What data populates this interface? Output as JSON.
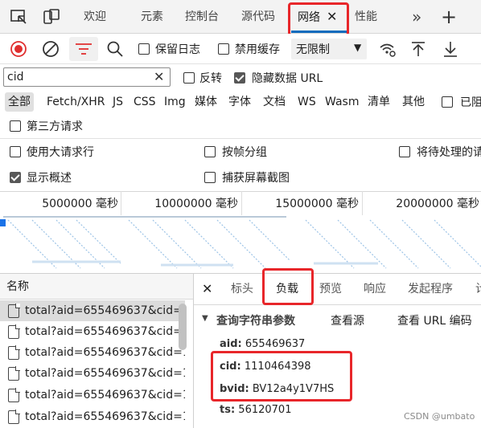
{
  "top_tabs": [
    {
      "label": "欢迎"
    },
    {
      "label": "元素"
    },
    {
      "label": "控制台"
    },
    {
      "label": "源代码"
    },
    {
      "label": "网络",
      "active": true
    },
    {
      "label": "性能"
    }
  ],
  "toolbar": {
    "preserve_log": "保留日志",
    "disable_cache": "禁用缓存",
    "throttling": "无限制"
  },
  "filter": {
    "value": "cid",
    "invert": "反转",
    "hide_data_urls": "隐藏数据 URL"
  },
  "type_filters": [
    "全部",
    "Fetch/XHR",
    "JS",
    "CSS",
    "Img",
    "媒体",
    "字体",
    "文档",
    "WS",
    "Wasm",
    "清单",
    "其他",
    "已阻"
  ],
  "third_party": "第三方请求",
  "options": {
    "large_rows": "使用大请求行",
    "group_by_frame": "按帧分组",
    "pending": "将待处理的请",
    "show_overview": "显示概述",
    "capture_screenshots": "捕获屏幕截图"
  },
  "timeline": {
    "ticks": [
      "5000000 毫秒",
      "10000000 毫秒",
      "15000000 毫秒",
      "20000000 毫秒"
    ]
  },
  "list": {
    "header": "名称",
    "items": [
      "total?aid=655469637&cid=1",
      "total?aid=655469637&cid=1",
      "total?aid=655469637&cid=1",
      "total?aid=655469637&cid=1",
      "total?aid=655469637&cid=1",
      "total?aid=655469637&cid=1"
    ]
  },
  "detail": {
    "tabs": [
      "标头",
      "负载",
      "预览",
      "响应",
      "发起程序",
      "计"
    ],
    "section_title": "查询字符串参数",
    "view_source": "查看源",
    "view_url_encoded": "查看 URL 编码",
    "params": [
      {
        "key": "aid:",
        "value": "655469637"
      },
      {
        "key": "cid:",
        "value": "1110464398"
      },
      {
        "key": "bvid:",
        "value": "BV12a4y1V7HS"
      },
      {
        "key": "ts:",
        "value": "56120701"
      }
    ]
  },
  "watermark": "CSDN @umbato",
  "colors": {
    "accent": "#0f6cbd",
    "highlight_red": "#e8262a",
    "record_red": "#e02f2f"
  }
}
